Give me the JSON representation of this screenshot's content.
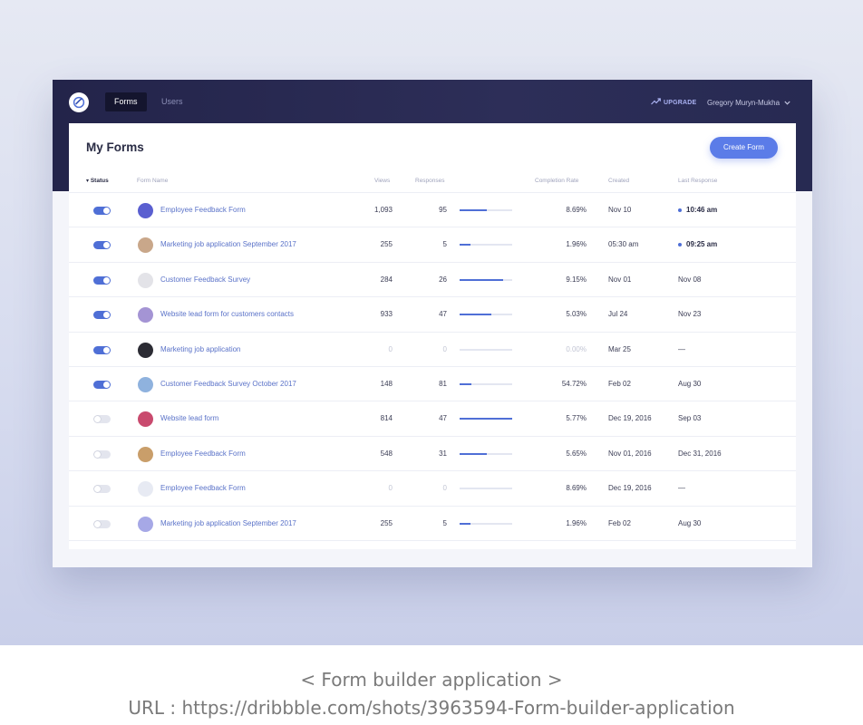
{
  "nav": {
    "tabs": [
      {
        "label": "Forms",
        "active": true
      },
      {
        "label": "Users",
        "active": false
      }
    ],
    "upgrade_label": "UPGRADE",
    "user_name": "Gregory Muryn-Mukha"
  },
  "main": {
    "title": "My Forms",
    "create_button": "Create Form",
    "columns": {
      "status": "Status",
      "form_name": "Form Name",
      "views": "Views",
      "responses": "Responses",
      "completion_rate": "Completion Rate",
      "created": "Created",
      "last_response": "Last Response"
    },
    "rows": [
      {
        "enabled": true,
        "avatar_color": "#5a5fd0",
        "name": "Employee Feedback Form",
        "views": "1,093",
        "responses": "95",
        "progress": 0.52,
        "rate": "8.69%",
        "created": "Nov 10",
        "last": "10:46 am",
        "last_new": true
      },
      {
        "enabled": true,
        "avatar_color": "#c9a78a",
        "name": "Marketing job application September 2017",
        "views": "255",
        "responses": "5",
        "progress": 0.2,
        "rate": "1.96%",
        "created": "05:30 am",
        "last": "09:25 am",
        "last_new": true
      },
      {
        "enabled": true,
        "avatar_color": "#e3e3e8",
        "name": "Customer Feedback Survey",
        "views": "284",
        "responses": "26",
        "progress": 0.82,
        "rate": "9.15%",
        "created": "Nov 01",
        "last": "Nov 08",
        "last_new": false
      },
      {
        "enabled": true,
        "avatar_color": "#a494d4",
        "name": "Website lead form for customers contacts",
        "views": "933",
        "responses": "47",
        "progress": 0.6,
        "rate": "5.03%",
        "created": "Jul 24",
        "last": "Nov 23",
        "last_new": false
      },
      {
        "enabled": true,
        "avatar_color": "#2c2c34",
        "name": "Marketing job application",
        "views": "0",
        "responses": "0",
        "progress": 0,
        "rate": "0.00%",
        "created": "Mar 25",
        "last": "—",
        "last_new": false,
        "muted": true
      },
      {
        "enabled": true,
        "avatar_color": "#8fb2de",
        "name": "Customer Feedback Survey October 2017",
        "views": "148",
        "responses": "81",
        "progress": 0.22,
        "rate": "54.72%",
        "created": "Feb 02",
        "last": "Aug 30",
        "last_new": false
      },
      {
        "enabled": false,
        "avatar_color": "#c94a6e",
        "name": "Website lead form",
        "views": "814",
        "responses": "47",
        "progress": 1.0,
        "rate": "5.77%",
        "created": "Dec 19, 2016",
        "last": "Sep 03",
        "last_new": false
      },
      {
        "enabled": false,
        "avatar_color": "#c99e6a",
        "name": "Employee Feedback Form",
        "views": "548",
        "responses": "31",
        "progress": 0.52,
        "rate": "5.65%",
        "created": "Nov 01, 2016",
        "last": "Dec 31, 2016",
        "last_new": false
      },
      {
        "enabled": false,
        "avatar_color": "#e7eaf3",
        "name": "Employee Feedback Form",
        "views": "0",
        "responses": "0",
        "progress": 0,
        "rate": "8.69%",
        "created": "Dec 19, 2016",
        "last": "—",
        "last_new": false,
        "muted_counts": true
      },
      {
        "enabled": false,
        "avatar_color": "#a6a8e6",
        "name": "Marketing job application September 2017",
        "views": "255",
        "responses": "5",
        "progress": 0.2,
        "rate": "1.96%",
        "created": "Feb 02",
        "last": "Aug 30",
        "last_new": false
      }
    ]
  },
  "caption": {
    "line1": "< Form builder application >",
    "line2": "URL : https://dribbble.com/shots/3963594-Form-builder-application"
  },
  "colors": {
    "accent": "#4f6fd6",
    "topbar": "#2a2b55",
    "link": "#5a72c8"
  }
}
